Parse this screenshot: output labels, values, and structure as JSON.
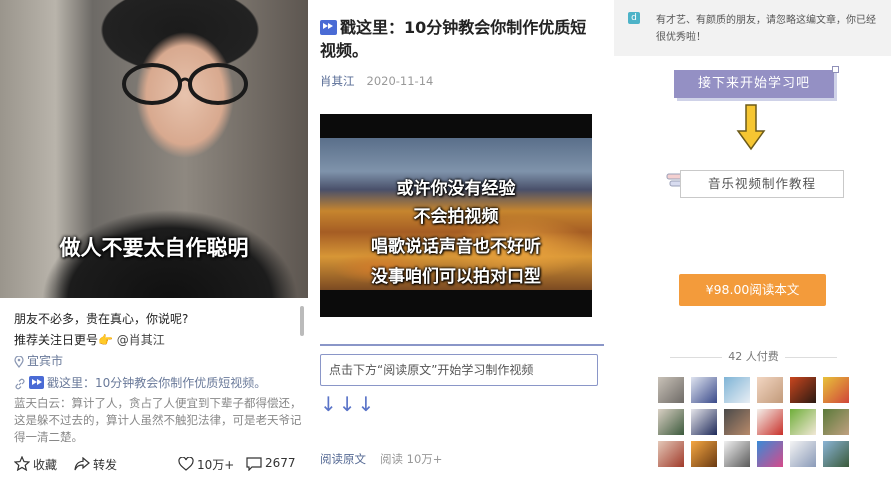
{
  "post": {
    "caption": "做人不要太自作聪明",
    "line1": "朋友不必多，贵在真心，你说呢?",
    "line2_prefix": "推荐关注日更号",
    "line2_mention": "@肖其江",
    "location": "宜宾市",
    "link_title": "戳这里：10分钟教会你制作优质短视频。",
    "body": "蓝天白云：算计了人，贪占了人便宜到下辈子都得偿还，这是躲不过去的，算计人虽然不触犯法律，可是老天爷记得一清二楚。",
    "actions": {
      "favorite": "收藏",
      "share": "转发",
      "likes": "10万+",
      "comments": "2677"
    }
  },
  "article": {
    "title": "戳这里：10分钟教会你制作优质短视频。",
    "author": "肖其江",
    "date": "2020-11-14",
    "video_subtitles": [
      "或许你没有经验",
      "不会拍视频",
      "唱歌说话声音也不好听",
      "没事咱们可以拍对口型"
    ],
    "cta_text": "点击下方“阅读原文”开始学习制作视频",
    "arrows": "↓↓↓",
    "footer": {
      "read_original": "阅读原文",
      "reads_label": "阅读 10万+"
    }
  },
  "paywall": {
    "badge": "d",
    "notice": "有才艺、有颜质的朋友，请忽略这编文章，你已经很优秀啦！",
    "start_button": "接下来开始学习吧",
    "tag_label": "音乐视频制作教程",
    "pay_button": "¥98.00阅读本文",
    "payers_count": "42 人付费",
    "colors": {
      "pay": "#f39b3b",
      "start": "#9490c4",
      "accent_link": "#576b95"
    }
  }
}
